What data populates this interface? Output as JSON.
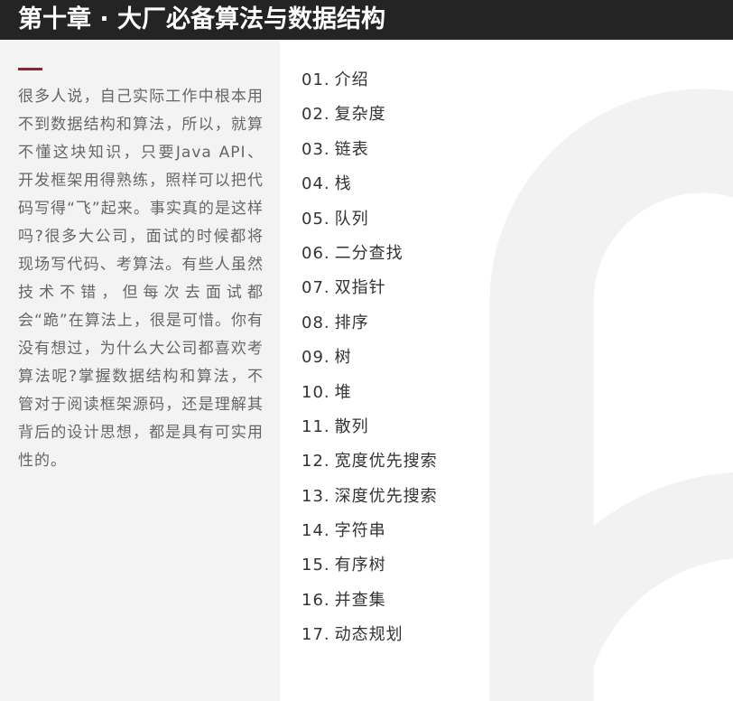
{
  "header": {
    "title": "第十章 · 大厂必备算法与数据结构"
  },
  "intro": {
    "text": "很多人说，自己实际工作中根本用不到数据结构和算法，所以，就算不懂这块知识，只要Java API、开发框架用得熟练，照样可以把代码写得“飞”起来。事实真的是这样吗?很多大公司，面试的时候都将现场写代码、考算法。有些人虽然技术不错，但每次去面试都会“跪”在算法上，很是可惜。你有没有想过，为什么大公司都喜欢考算法呢?掌握数据结构和算法，不管对于阅读框架源码，还是理解其背后的设计思想，都是具有可实用性的。"
  },
  "toc": [
    {
      "num": "01.",
      "title": "介绍"
    },
    {
      "num": "02.",
      "title": "复杂度"
    },
    {
      "num": "03.",
      "title": "链表"
    },
    {
      "num": "04.",
      "title": "栈"
    },
    {
      "num": "05.",
      "title": "队列"
    },
    {
      "num": "06.",
      "title": "二分查找"
    },
    {
      "num": "07.",
      "title": "双指针"
    },
    {
      "num": "08.",
      "title": "排序"
    },
    {
      "num": "09.",
      "title": "树"
    },
    {
      "num": "10.",
      "title": "堆"
    },
    {
      "num": "11.",
      "title": "散列"
    },
    {
      "num": "12.",
      "title": "宽度优先搜索"
    },
    {
      "num": "13.",
      "title": "深度优先搜索"
    },
    {
      "num": "14.",
      "title": "字符串"
    },
    {
      "num": "15.",
      "title": "有序树"
    },
    {
      "num": "16.",
      "title": "并查集"
    },
    {
      "num": "17.",
      "title": "动态规划"
    }
  ],
  "colors": {
    "header_bg": "#242424",
    "accent": "#8a2532",
    "left_panel_bg": "#f3f3f3",
    "decoration": "#f2f2f2"
  }
}
